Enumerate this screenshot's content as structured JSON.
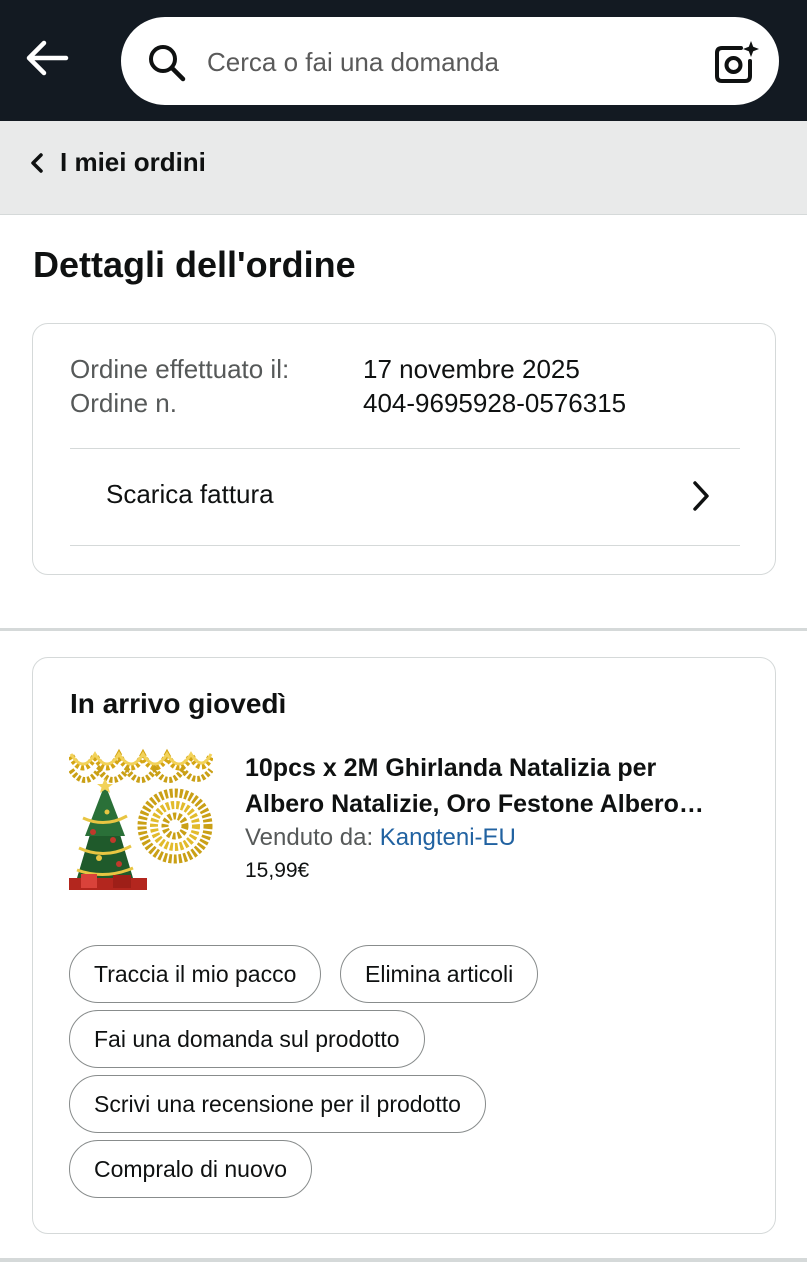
{
  "header": {
    "search_placeholder": "Cerca o fai una domanda",
    "background": "#131a22"
  },
  "breadcrumb": {
    "label": "I miei ordini"
  },
  "page": {
    "title": "Dettagli dell'ordine"
  },
  "order_info": {
    "date_label": "Ordine effettuato il:",
    "date_value": "17 novembre 2025",
    "number_label": "Ordine n.",
    "number_value": "404-9695928-0576315",
    "invoice_label": "Scarica fattura"
  },
  "shipment": {
    "arrival": "In arrivo giovedì",
    "product": {
      "title_line1": "10pcs x 2M Ghirlanda Natalizia per",
      "title_line2": "Albero Natalizie, Oro Festone Albero…",
      "seller_label": "Venduto da:",
      "seller_name": "Kangteni-EU",
      "price": "15,99€"
    },
    "actions": {
      "track": "Traccia il mio pacco",
      "delete": "Elimina articoli",
      "ask": "Fai una domanda sul prodotto",
      "review": "Scrivi una recensione per il prodotto",
      "buy_again": "Compralo di nuovo"
    }
  },
  "icons": {
    "back": "back-arrow-icon",
    "search": "search-icon",
    "camera": "camera-icon",
    "chevron_left": "chevron-left-icon",
    "chevron_right": "chevron-right-icon"
  },
  "colors": {
    "link": "#2162a1",
    "crumb_background": "#e9eaea"
  }
}
